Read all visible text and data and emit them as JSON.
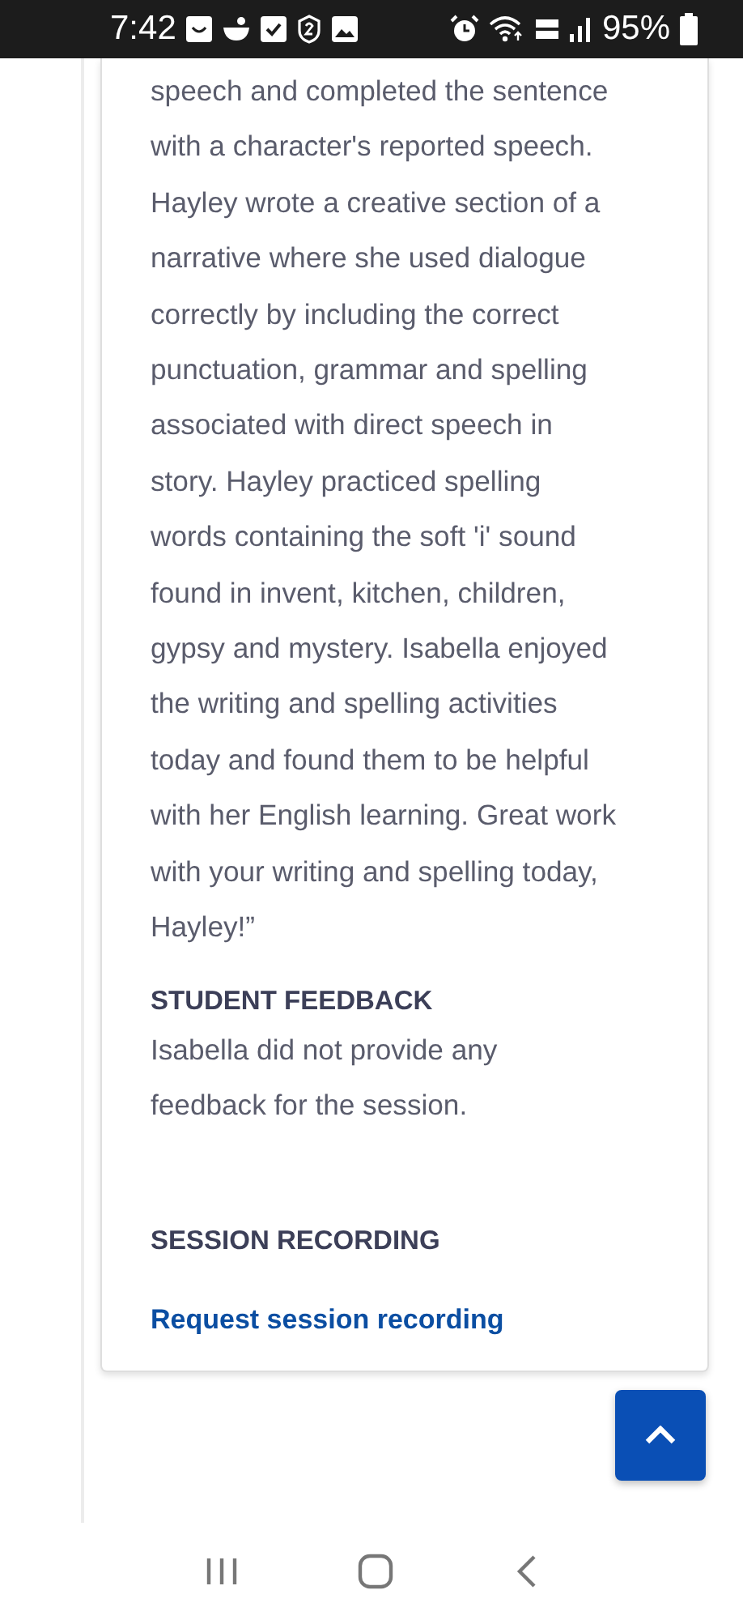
{
  "status_bar": {
    "time": "7:42",
    "battery": "95%"
  },
  "summary": {
    "lines": [
      "speech and completed the sentence",
      "with a character's reported speech.",
      "Hayley wrote a creative section of a",
      "narrative where she used dialogue",
      "correctly by including the correct",
      "punctuation, grammar and spelling",
      "associated with direct speech in",
      "story. Hayley practiced spelling",
      "words containing the soft 'i' sound",
      "found in invent, kitchen, children,",
      "gypsy and mystery. Isabella enjoyed",
      "the writing and spelling activities",
      "today and found them to be helpful",
      "with her English learning. Great work",
      "with your writing and spelling today,",
      "Hayley!”"
    ]
  },
  "student_feedback": {
    "heading": "STUDENT FEEDBACK",
    "text_lines": [
      "Isabella did not provide any",
      "feedback for the session."
    ]
  },
  "session_recording": {
    "heading": "SESSION RECORDING",
    "link": "Request session recording"
  }
}
